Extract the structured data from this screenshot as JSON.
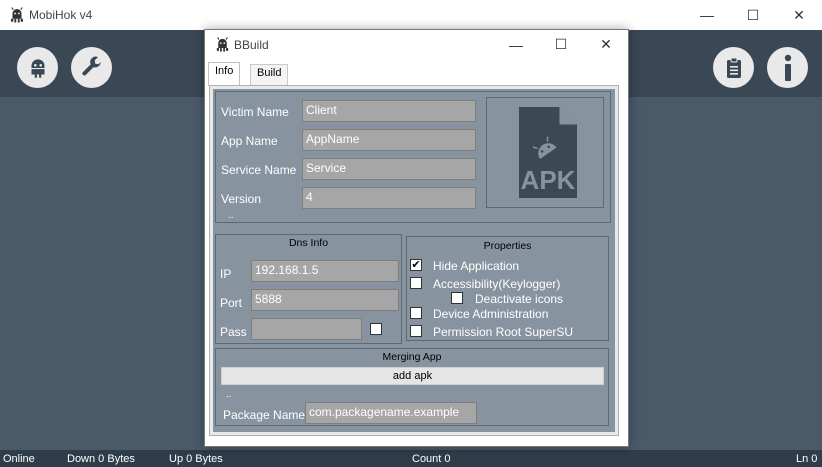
{
  "main_window": {
    "title": "MobiHok v4",
    "controls": {
      "minimize": "—",
      "maximize": "☐",
      "close": "✕"
    },
    "toolbar": {
      "left_icons": [
        "android-icon",
        "wrench-icon"
      ],
      "right_icons": [
        "clipboard-icon",
        "info-icon"
      ]
    }
  },
  "statusbar": {
    "online": "Online",
    "down": "Down 0 Bytes",
    "up": "Up 0 Bytes",
    "count": "Count 0",
    "ln": "Ln 0"
  },
  "dialog": {
    "title": "BBuild",
    "controls": {
      "minimize": "—",
      "maximize": "☐",
      "close": "✕"
    },
    "tabs": [
      {
        "label": "Info",
        "active": true
      },
      {
        "label": "Build",
        "active": false
      }
    ],
    "info": {
      "victim_name": {
        "label": "Victim Name",
        "value": "Client"
      },
      "app_name": {
        "label": "App Name",
        "value": "AppName"
      },
      "service_name": {
        "label": "Service Name",
        "value": "Service"
      },
      "version": {
        "label": "Version",
        "value": "4"
      },
      "dots": "..",
      "apk_icon_text": "APK"
    },
    "dns": {
      "title": "Dns Info",
      "ip": {
        "label": "IP",
        "value": "192.168.1.5"
      },
      "port": {
        "label": "Port",
        "value": "5888"
      },
      "pass": {
        "label": "Pass",
        "value": ""
      },
      "pass_checked": false
    },
    "properties": {
      "title": "Properties",
      "hide_application": {
        "label": "Hide Application",
        "checked": true
      },
      "accessibility": {
        "label": "Accessibility(Keylogger)",
        "checked": false
      },
      "deactivate_icons": {
        "label": "Deactivate icons",
        "checked": false
      },
      "device_admin": {
        "label": "Device Administration",
        "checked": false
      },
      "root": {
        "label": "Permission Root SuperSU",
        "checked": false
      },
      "check_mark": "✔"
    },
    "merging": {
      "title": "Merging App",
      "add_button": "add apk",
      "dots": "..",
      "package_name": {
        "label": "Package Name",
        "value": "com.packagename.example"
      }
    }
  },
  "colors": {
    "toolbar_bg": "#3a4754",
    "body_bg": "#4a5a69",
    "panel_bg": "#8794a0",
    "field_bg": "#a6a6a6",
    "statusbar_bg": "#2f3d4a"
  }
}
